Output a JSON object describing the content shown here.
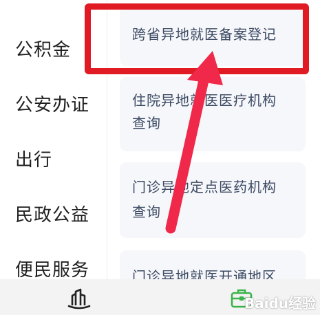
{
  "sidebar": {
    "items": [
      {
        "label": "公积金"
      },
      {
        "label": "公安办证"
      },
      {
        "label": "出行"
      },
      {
        "label": "民政公益"
      },
      {
        "label": "便民服务"
      }
    ]
  },
  "content": {
    "cards": [
      {
        "line1": "跨省异地就医备案登记",
        "line2": ""
      },
      {
        "line1": "住院异地就医医疗机构",
        "line2": "查询"
      },
      {
        "line1": "门诊异地定点医药机构",
        "line2": "查询"
      },
      {
        "line1": "门诊异地就医开通地区",
        "line2": ""
      }
    ]
  },
  "watermark": {
    "text": "Baidu经验"
  },
  "colors": {
    "highlight": "#e01b24",
    "arrow": "#f0284a",
    "tab_active": "#3bb34a",
    "card_bg": "#f6f7fa",
    "card_text": "#3c4a63"
  },
  "tabbar": {
    "tabs": [
      {
        "icon": "city-buildings-icon",
        "active": false
      },
      {
        "icon": "briefcase-icon",
        "active": true
      }
    ]
  }
}
